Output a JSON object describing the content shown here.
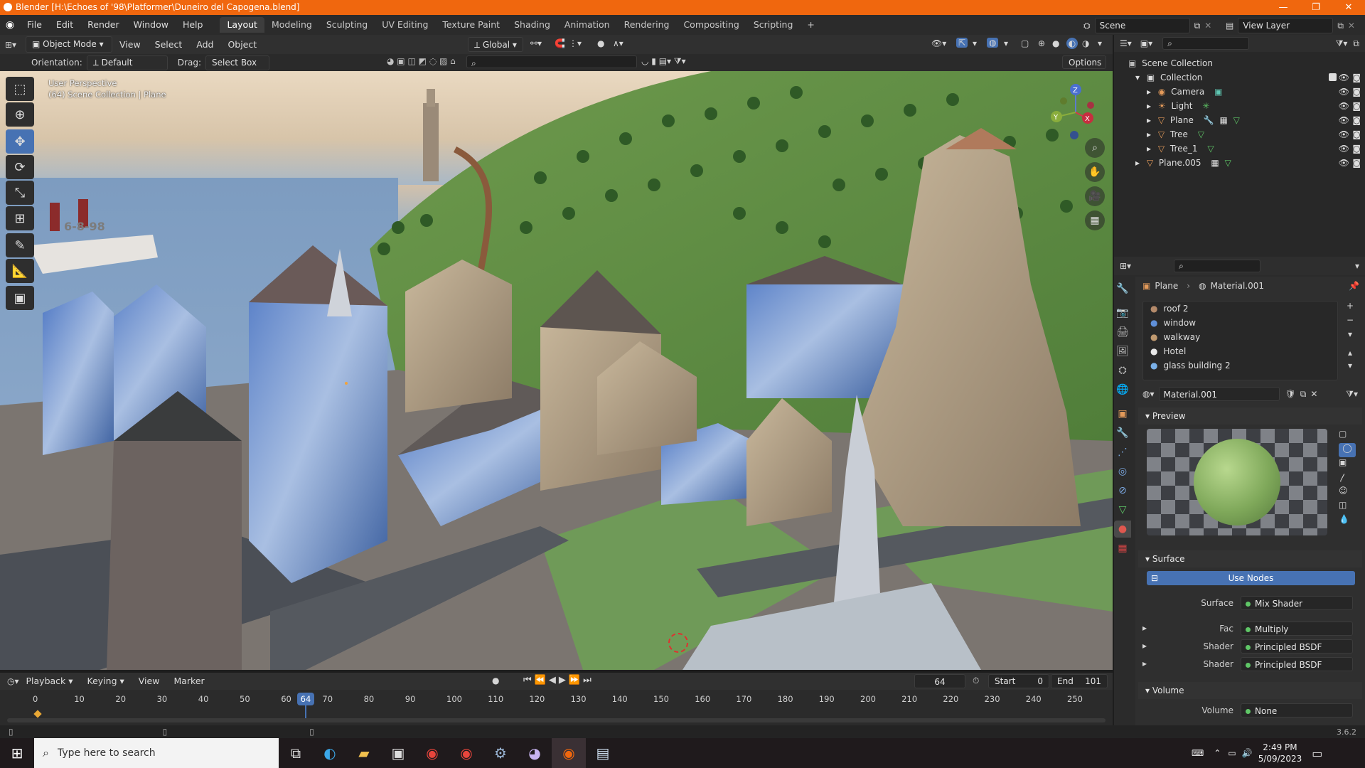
{
  "window": {
    "title": "Blender [H:\\Echoes of '98\\Platformer\\Duneiro del Capogena.blend]",
    "accent": "#f0670e",
    "controls": [
      "minimize-icon",
      "restore-icon",
      "close-icon"
    ]
  },
  "menu": {
    "items": [
      "File",
      "Edit",
      "Render",
      "Window",
      "Help"
    ],
    "workspaces": [
      "Layout",
      "Modeling",
      "Sculpting",
      "UV Editing",
      "Texture Paint",
      "Shading",
      "Animation",
      "Rendering",
      "Compositing",
      "Scripting"
    ],
    "active_workspace": "Layout",
    "add_workspace": "+",
    "scene_label": "Scene",
    "view_layer_label": "View Layer"
  },
  "viewport_header": {
    "mode": "Object Mode",
    "menus": [
      "View",
      "Select",
      "Add",
      "Object"
    ],
    "transform_orientation": "Global",
    "orientation_label": "Orientation:",
    "orientation_value": "Default",
    "drag_label": "Drag:",
    "drag_value": "Select Box",
    "options_label": "Options"
  },
  "viewport": {
    "overlay_line1": "User Perspective",
    "overlay_line2": "(64) Scene Collection | Plane",
    "ship_text": "6-8-98",
    "gizmo_axes": [
      "Z",
      "Y",
      "X"
    ]
  },
  "tools": [
    "select-box-icon",
    "cursor-icon",
    "move-icon",
    "rotate-icon",
    "scale-icon",
    "transform-icon",
    "annotate-icon",
    "measure-icon",
    "add-cube-icon"
  ],
  "outliner": {
    "root": "Scene Collection",
    "collection": "Collection",
    "items": [
      {
        "name": "Camera",
        "icon": "camera-icon"
      },
      {
        "name": "Light",
        "icon": "light-icon"
      },
      {
        "name": "Plane",
        "icon": "mesh-icon"
      },
      {
        "name": "Tree",
        "icon": "mesh-icon"
      },
      {
        "name": "Tree_1",
        "icon": "mesh-icon"
      }
    ],
    "top_item": "Plane.005"
  },
  "properties": {
    "breadcrumb_object": "Plane",
    "breadcrumb_material": "Material.001",
    "material_slots": [
      "roof 2",
      "window",
      "walkway",
      "Hotel",
      "glass building 2"
    ],
    "material_name": "Material.001",
    "preview_label": "Preview",
    "surface_section": "Surface",
    "use_nodes_label": "Use Nodes",
    "rows": [
      {
        "label": "Surface",
        "value": "Mix Shader"
      },
      {
        "label": "Fac",
        "value": "Multiply"
      },
      {
        "label": "Shader",
        "value": "Principled BSDF"
      },
      {
        "label": "Shader",
        "value": "Principled BSDF"
      }
    ],
    "volume_section": "Volume",
    "volume_label": "Volume",
    "volume_value": "None",
    "accent": "#4772b3"
  },
  "timeline": {
    "menus": [
      "Playback",
      "Keying",
      "View",
      "Marker"
    ],
    "current_frame": "64",
    "start_label": "Start",
    "start_value": "0",
    "end_label": "End",
    "end_value": "101",
    "ticks": [
      "0",
      "10",
      "20",
      "30",
      "40",
      "50",
      "60",
      "70",
      "80",
      "90",
      "100",
      "110",
      "120",
      "130",
      "140",
      "150",
      "160",
      "170",
      "180",
      "190",
      "200",
      "210",
      "220",
      "230",
      "240",
      "250"
    ],
    "playhead_label": "64"
  },
  "status": {
    "version": "3.6.2"
  },
  "taskbar": {
    "search_placeholder": "Type here to search",
    "time": "2:49 PM",
    "date": "5/09/2023",
    "apps": [
      "task-view-icon",
      "edge-icon",
      "file-explorer-icon",
      "store-icon",
      "chrome-icon",
      "chrome-icon",
      "steam-icon",
      "github-icon",
      "blender-icon",
      "notepad-icon"
    ]
  }
}
